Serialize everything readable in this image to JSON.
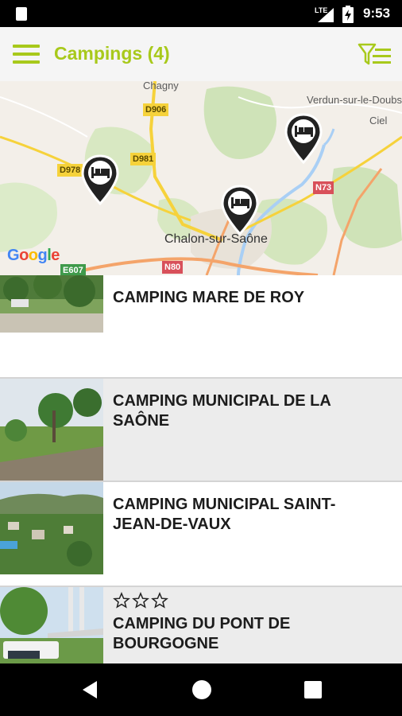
{
  "status_bar": {
    "time": "9:53",
    "network": "LTE"
  },
  "app_bar": {
    "title": "Campings (4)"
  },
  "map": {
    "labels": {
      "chagny": "Chagny",
      "verdun": "Verdun-sur-le-Doubs",
      "ciel": "Ciel",
      "chalon": "Chalon-sur-Saône"
    },
    "road_badges": {
      "d906": "D906",
      "d981": "D981",
      "d978": "D978",
      "n73": "N73",
      "n80": "N80",
      "e607": "E607"
    },
    "attribution": "Google"
  },
  "campings": [
    {
      "name": "CAMPING MARE DE ROY",
      "stars": 0
    },
    {
      "name": "CAMPING MUNICIPAL DE LA SAÔNE",
      "stars": 0
    },
    {
      "name": "CAMPING MUNICIPAL SAINT-JEAN-DE-VAUX",
      "stars": 0
    },
    {
      "name": "CAMPING DU PONT DE BOURGOGNE",
      "stars": 3
    }
  ],
  "colors": {
    "accent": "#a8c91b",
    "alt_row": "#ececec"
  }
}
